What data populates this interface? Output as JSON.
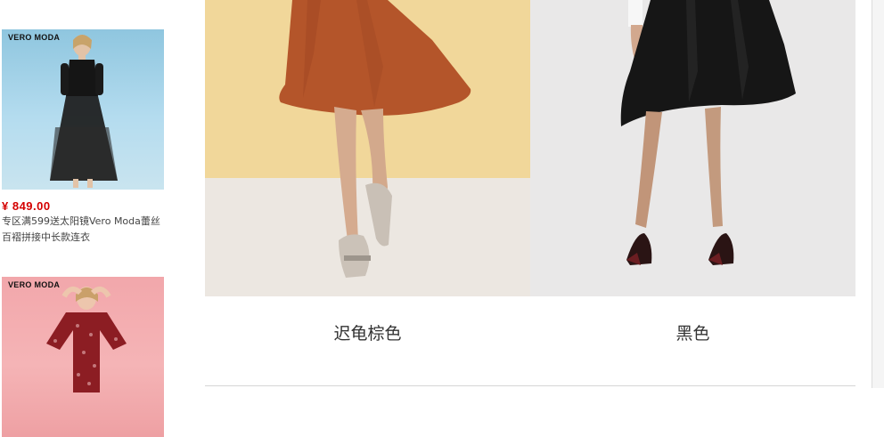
{
  "sidebar": {
    "products": [
      {
        "brand": "VERO MODA",
        "price": "¥ 849.00",
        "desc": "专区满599送太阳镜Vero Moda蕾丝百褶拼接中长款连衣"
      },
      {
        "brand": "VERO MODA"
      }
    ]
  },
  "main": {
    "variants": [
      {
        "label": "迟龟棕色",
        "image": "rust-skirt-photo"
      },
      {
        "label": "黑色",
        "image": "black-skirt-photo"
      }
    ]
  },
  "colors": {
    "price": "#d40000",
    "rust": "#b4552a",
    "black_skirt": "#161616",
    "beige_wall": "#f1d79a",
    "floor": "#ece7e1",
    "grey_wall": "#e9e8e8"
  }
}
